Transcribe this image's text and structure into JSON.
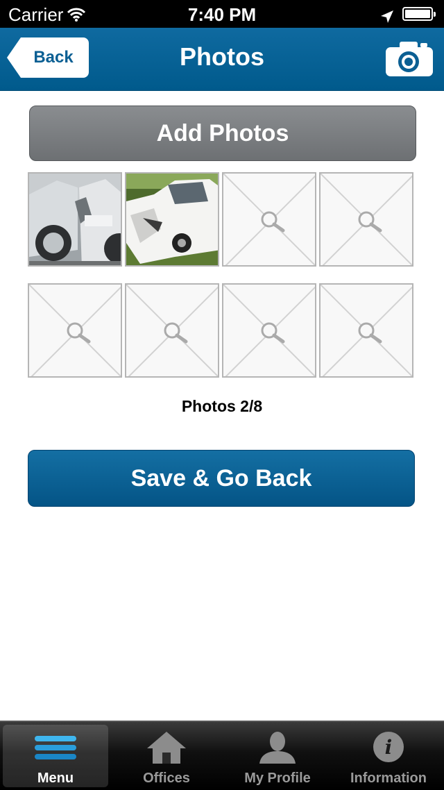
{
  "status_bar": {
    "carrier": "Carrier",
    "time": "7:40 PM"
  },
  "nav": {
    "back_label": "Back",
    "title": "Photos",
    "camera_icon": "camera-icon"
  },
  "add_photos_label": "Add Photos",
  "photos": {
    "count_text": "Photos 2/8",
    "slots": [
      {
        "filled": true,
        "desc": "car crash photo"
      },
      {
        "filled": true,
        "desc": "car crash photo"
      },
      {
        "filled": false
      },
      {
        "filled": false
      },
      {
        "filled": false
      },
      {
        "filled": false
      },
      {
        "filled": false
      },
      {
        "filled": false
      }
    ]
  },
  "save_label": "Save & Go Back",
  "tab_bar": {
    "tabs": [
      {
        "label": "Menu",
        "icon": "menu-icon",
        "active": true
      },
      {
        "label": "Offices",
        "icon": "home-icon",
        "active": false
      },
      {
        "label": "My Profile",
        "icon": "person-icon",
        "active": false
      },
      {
        "label": "Information",
        "icon": "info-icon",
        "active": false
      }
    ]
  },
  "colors": {
    "nav_blue": "#0a62a0",
    "button_gray": "#7a7d80",
    "tab_bg": "#000000"
  }
}
